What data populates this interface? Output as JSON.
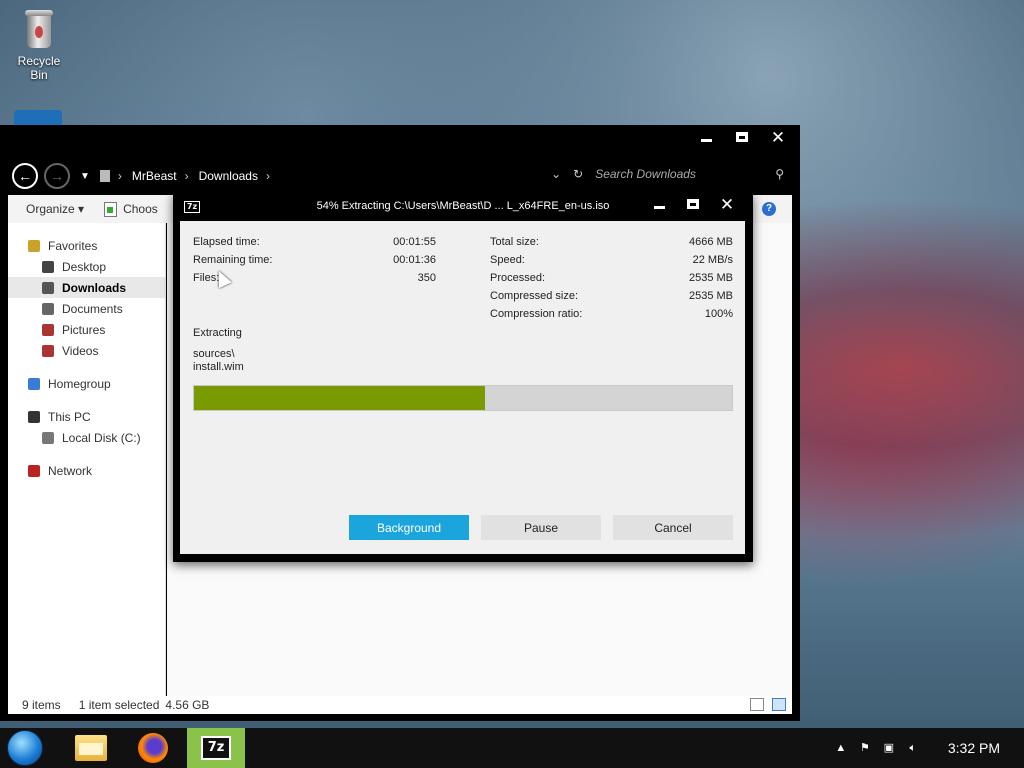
{
  "desktop": {
    "recycle_bin_label": "Recycle Bin"
  },
  "explorer": {
    "breadcrumb": [
      "MrBeast",
      "Downloads"
    ],
    "search_placeholder": "Search Downloads",
    "toolbar": {
      "organize": "Organize",
      "choose": "Choos"
    },
    "sidebar": [
      {
        "label": "Favorites",
        "level": 1,
        "icon": "star-icon"
      },
      {
        "label": "Desktop",
        "level": 2,
        "icon": "desktop-icon"
      },
      {
        "label": "Downloads",
        "level": 2,
        "icon": "downloads-icon",
        "selected": true
      },
      {
        "label": "Documents",
        "level": 2,
        "icon": "documents-icon"
      },
      {
        "label": "Pictures",
        "level": 2,
        "icon": "pictures-icon"
      },
      {
        "label": "Videos",
        "level": 2,
        "icon": "videos-icon"
      },
      {
        "label": "Homegroup",
        "level": 1,
        "icon": "homegroup-icon"
      },
      {
        "label": "This PC",
        "level": 1,
        "icon": "computer-icon"
      },
      {
        "label": "Local Disk (C:)",
        "level": 2,
        "icon": "disk-icon"
      },
      {
        "label": "Network",
        "level": 1,
        "icon": "network-icon"
      }
    ],
    "status": {
      "items": "9 items",
      "selected": "1 item selected",
      "size": "4.56 GB"
    }
  },
  "dialog": {
    "title": "54% Extracting C:\\Users\\MrBeast\\D ... L_x64FRE_en-us.iso",
    "logo_text": "7z",
    "left_stats": [
      {
        "label": "Elapsed time:",
        "value": "00:01:55"
      },
      {
        "label": "Remaining time:",
        "value": "00:01:36"
      },
      {
        "label": "Files:",
        "value": "350"
      }
    ],
    "right_stats": [
      {
        "label": "Total size:",
        "value": "4666 MB"
      },
      {
        "label": "Speed:",
        "value": "22 MB/s"
      },
      {
        "label": "Processed:",
        "value": "2535 MB"
      },
      {
        "label": "Compressed size:",
        "value": "2535 MB"
      },
      {
        "label": "Compression ratio:",
        "value": "100%"
      }
    ],
    "extracting_label": "Extracting",
    "current_path": "sources\\",
    "current_file": "install.wim",
    "progress_percent": 54,
    "buttons": {
      "background": "Background",
      "pause": "Pause",
      "cancel": "Cancel"
    },
    "colors": {
      "progress": "#7a9a01",
      "primary_button": "#1ca5dc"
    }
  },
  "taskbar": {
    "clock": "3:32 PM",
    "active_app_label": "7z"
  }
}
